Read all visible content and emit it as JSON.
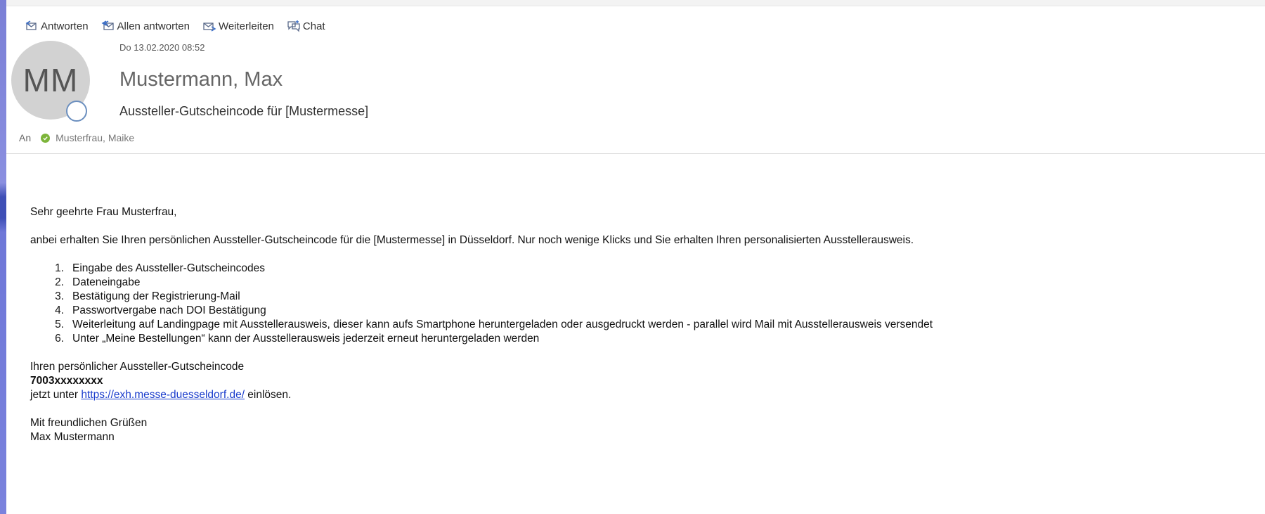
{
  "toolbar": {
    "reply": "Antworten",
    "reply_all": "Allen antworten",
    "forward": "Weiterleiten",
    "chat": "Chat"
  },
  "header": {
    "avatar_initials": "MM",
    "date": "Do 13.02.2020 08:52",
    "sender": "Mustermann, Max",
    "subject": "Aussteller-Gutscheincode für [Mustermesse]",
    "to_label": "An",
    "recipient": "Musterfrau, Maike"
  },
  "body": {
    "greeting": "Sehr geehrte Frau  Musterfrau,",
    "intro": "anbei erhalten Sie Ihren persönlichen Aussteller-Gutscheincode für die [Mustermesse] in Düsseldorf. Nur noch wenige Klicks und Sie erhalten Ihren personalisierten Ausstellerausweis.",
    "steps": [
      {
        "num": "1.",
        "text": "Eingabe des Aussteller-Gutscheincodes"
      },
      {
        "num": "2.",
        "text": "Dateneingabe"
      },
      {
        "num": "3.",
        "text": "Bestätigung der Registrierung-Mail"
      },
      {
        "num": "4.",
        "text": "Passwortvergabe nach DOI Bestätigung"
      },
      {
        "num": "5.",
        "text": "Weiterleitung auf Landingpage mit Ausstellerausweis, dieser kann aufs Smartphone heruntergeladen oder ausgedruckt werden - parallel wird Mail mit Ausstellerausweis versendet"
      },
      {
        "num": "6.",
        "text": "Unter „Meine Bestellungen“ kann der Ausstellerausweis jederzeit erneut heruntergeladen werden"
      }
    ],
    "code_intro": "Ihren persönlicher Aussteller-Gutscheincode",
    "code": "7003xxxxxxxx",
    "redeem_prefix": "jetzt unter ",
    "redeem_link": "https://exh.messe-duesseldorf.de/",
    "redeem_suffix": " einlösen.",
    "closing": "Mit freundlichen Grüßen",
    "signature": "Max Mustermann"
  }
}
